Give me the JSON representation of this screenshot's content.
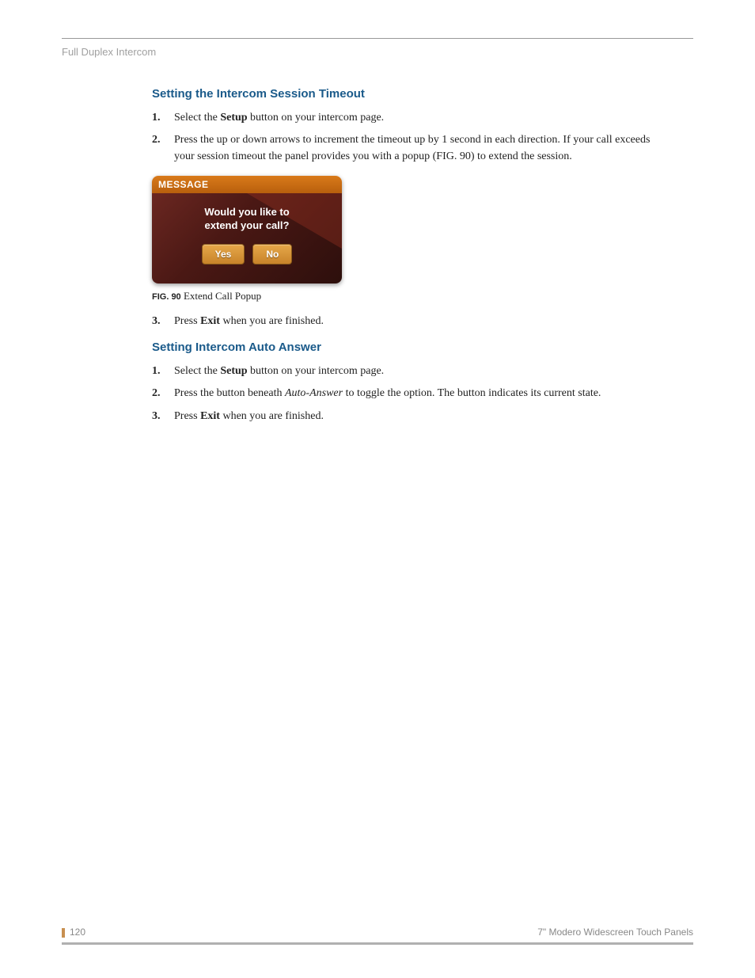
{
  "header": {
    "breadcrumb": "Full Duplex Intercom"
  },
  "section1": {
    "heading": "Setting the Intercom Session Timeout",
    "step1_a": "Select the ",
    "step1_b": "Setup",
    "step1_c": " button on your intercom page.",
    "step2": "Press the up or down arrows to increment the timeout up by 1 second in each direction. If your call exceeds your session timeout the panel provides you with a popup (FIG. 90) to extend the session.",
    "step3_a": "Press ",
    "step3_b": "Exit",
    "step3_c": " when you are finished."
  },
  "popup": {
    "title": "MESSAGE",
    "line1": "Would you like to",
    "line2": "extend your call?",
    "yes": "Yes",
    "no": "No"
  },
  "figure": {
    "label": "FIG. 90",
    "caption": "Extend Call Popup"
  },
  "section2": {
    "heading": "Setting Intercom Auto Answer",
    "step1_a": "Select the ",
    "step1_b": "Setup",
    "step1_c": " button on your intercom page.",
    "step2_a": "Press the button beneath ",
    "step2_b": "Auto-Answer",
    "step2_c": " to toggle the option. The button indicates its current state.",
    "step3_a": "Press ",
    "step3_b": "Exit",
    "step3_c": " when you are finished."
  },
  "footer": {
    "page": "120",
    "title": "7\" Modero Widescreen Touch Panels"
  }
}
